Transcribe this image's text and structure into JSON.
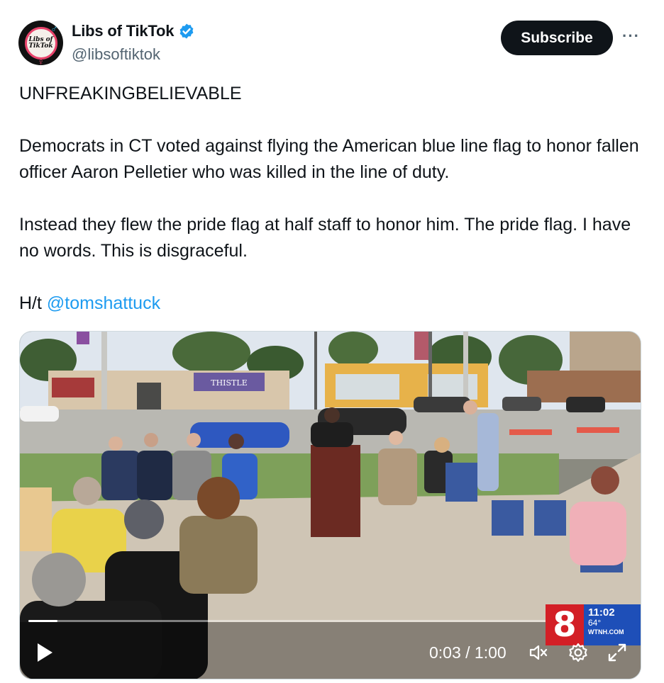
{
  "author": {
    "avatar_text": "Libs of TikTok",
    "display_name": "Libs of TikTok",
    "handle": "@libsoftiktok",
    "verified": true
  },
  "actions": {
    "subscribe_label": "Subscribe",
    "more_label": "···"
  },
  "tweet": {
    "line1": "UNFREAKINGBELIEVABLE",
    "para1": "Democrats in CT voted against flying the American blue line flag to honor fallen officer Aaron Pelletier who was killed in the line of duty.",
    "para2": "Instead they flew the pride flag at half staff to honor him. The pride flag. I have no words. This is disgraceful.",
    "hat_tip_prefix": "H/t ",
    "mention": "@tomshattuck"
  },
  "video": {
    "store_sign": "THISTLE",
    "station_number": "8",
    "station_time": "11:02",
    "station_temp": "64°",
    "station_site": "WTNH.COM",
    "elapsed": "0:03",
    "duration": "1:00",
    "time_display": "0:03 / 1:00",
    "progress": 0.05
  },
  "colors": {
    "link": "#1d9bf0",
    "text": "#0f1419",
    "secondary": "#536471",
    "verified": "#1d9bf0",
    "station_red": "#d31f26",
    "station_blue": "#1e4fb8"
  },
  "icons": {
    "verified": "verified-badge-icon",
    "play": "play-icon",
    "mute": "muted-speaker-icon",
    "settings": "gear-icon",
    "fullscreen": "expand-icon"
  }
}
